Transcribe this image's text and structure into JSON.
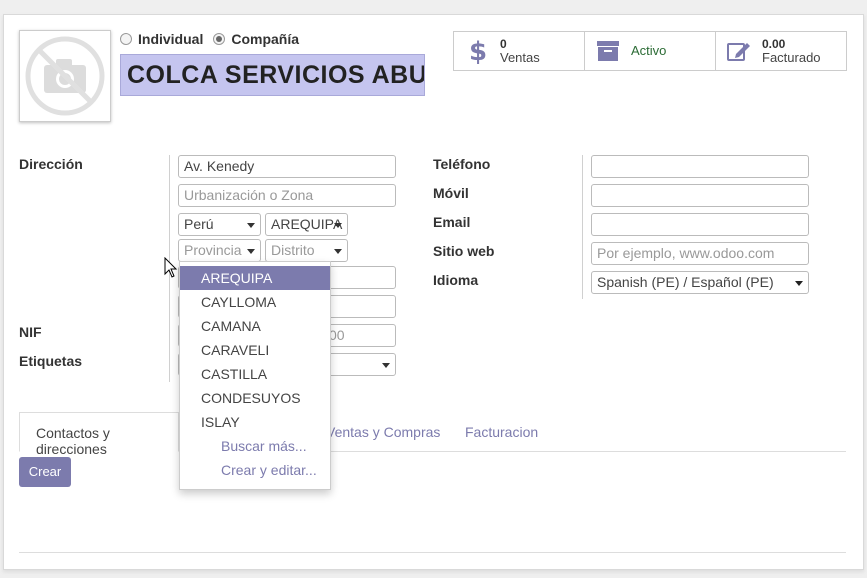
{
  "header": {
    "company_type_options": [
      "Individual",
      "Compañía"
    ],
    "company_type_selected": "Compañía",
    "name": "COLCA SERVICIOS ABUELO"
  },
  "stats": [
    {
      "icon": "dollar-icon",
      "value": "0",
      "label": "Ventas"
    },
    {
      "icon": "archive-icon",
      "value": "",
      "label": "Activo"
    },
    {
      "icon": "edit-icon",
      "value": "0.00",
      "label": "Facturado"
    }
  ],
  "address": {
    "label": "Dirección",
    "street": "Av. Kenedy",
    "street2_placeholder": "Urbanización o Zona",
    "country": "Perú",
    "state": "AREQUIPA",
    "province_placeholder": "Provincia",
    "district_placeholder": "Distrito",
    "vat_value_partial": "00"
  },
  "left_labels": {
    "vat": "NIF",
    "tags": "Etiquetas"
  },
  "contact": {
    "phone_label": "Teléfono",
    "mobile_label": "Móvil",
    "email_label": "Email",
    "website_label": "Sitio web",
    "website_placeholder": "Por ejemplo, www.odoo.com",
    "lang_label": "Idioma",
    "lang_value": "Spanish (PE) / Español (PE)"
  },
  "dropdown": {
    "items": [
      "AREQUIPA",
      "CAYLLOMA",
      "CAMANA",
      "CARAVELI",
      "CASTILLA",
      "CONDESUYOS",
      "ISLAY"
    ],
    "highlighted": "AREQUIPA",
    "search_more": "Buscar más...",
    "create_edit": "Crear y editar..."
  },
  "tabs": {
    "contacts": "Contactos y direcciones",
    "sales_purchases_partial": "Ventas y Compras",
    "invoicing": "Facturacion"
  },
  "buttons": {
    "create": "Crear"
  },
  "colors": {
    "accent": "#7c7bad",
    "name_bg": "#c5c5ef",
    "active_green": "#2b6b35"
  }
}
